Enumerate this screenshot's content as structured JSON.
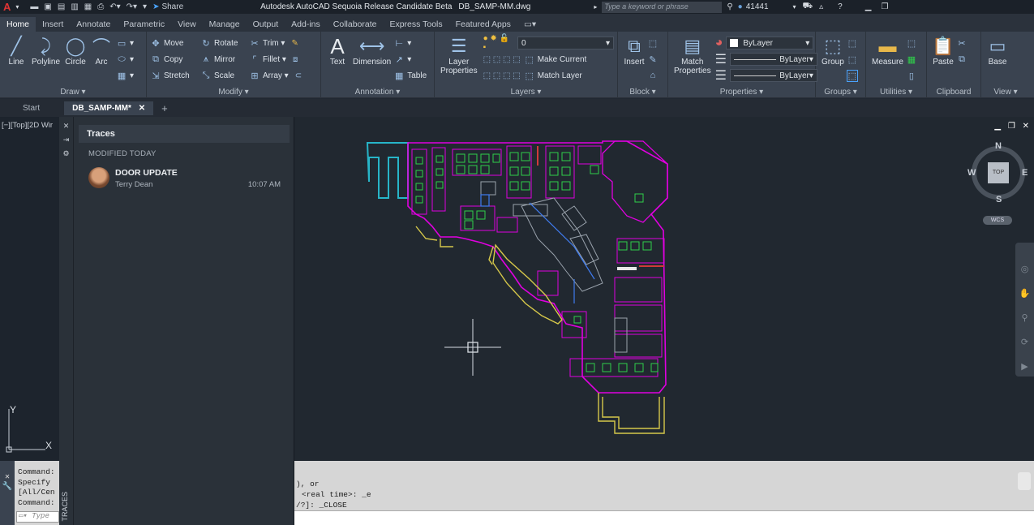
{
  "titlebar": {
    "app_letter": "A",
    "share_label": "Share",
    "title": "Autodesk AutoCAD Sequoia Release Candidate Beta",
    "filename": "DB_SAMP-MM.dwg",
    "search_placeholder": "Type a keyword or phrase",
    "user": "41441"
  },
  "ribbon_tabs": [
    "Home",
    "Insert",
    "Annotate",
    "Parametric",
    "View",
    "Manage",
    "Output",
    "Add-ins",
    "Collaborate",
    "Express Tools",
    "Featured Apps"
  ],
  "draw": {
    "line": "Line",
    "polyline": "Polyline",
    "circle": "Circle",
    "arc": "Arc",
    "title": "Draw"
  },
  "modify": {
    "move": "Move",
    "rotate": "Rotate",
    "trim": "Trim",
    "copy": "Copy",
    "mirror": "Mirror",
    "fillet": "Fillet",
    "stretch": "Stretch",
    "scale": "Scale",
    "array": "Array",
    "title": "Modify"
  },
  "annotation": {
    "text": "Text",
    "dimension": "Dimension",
    "table": "Table",
    "title": "Annotation"
  },
  "layers": {
    "layer_properties_1": "Layer",
    "layer_properties_2": "Properties",
    "layer_value": "0",
    "make_current": "Make Current",
    "match_layer": "Match Layer",
    "title": "Layers"
  },
  "block": {
    "insert": "Insert",
    "title": "Block"
  },
  "properties": {
    "match_1": "Match",
    "match_2": "Properties",
    "bylayer_color": "ByLayer",
    "bylayer_lineweight": "ByLayer",
    "bylayer_linetype": "ByLayer",
    "title": "Properties"
  },
  "groups": {
    "group": "Group",
    "title": "Groups"
  },
  "utilities": {
    "measure": "Measure",
    "title": "Utilities"
  },
  "clipboard": {
    "paste": "Paste",
    "title": "Clipboard"
  },
  "view": {
    "base": "Base",
    "title": "View"
  },
  "doc_tabs": {
    "start": "Start",
    "active": "DB_SAMP-MM*",
    "plus": "+"
  },
  "viewport_label": "[−][Top][2D Wir",
  "traces": {
    "title": "Traces",
    "section": "MODIFIED TODAY",
    "item_title": "DOOR UPDATE",
    "item_author": "Terry Dean",
    "item_time": "10:07 AM",
    "vertical_label": "TRACES"
  },
  "viewcube": {
    "n": "N",
    "s": "S",
    "e": "E",
    "w": "W",
    "top": "TOP",
    "wcs": "WCS"
  },
  "ucs": {
    "x": "X",
    "y": "Y"
  },
  "cmd_left": [
    "Command:",
    "Specify",
    "[All/Cen",
    "Command:"
  ],
  "cmd_input_placeholder": "Type",
  "cmd_history": [
    "), or",
    "<real time>: _e",
    "/?]: _CLOSE"
  ],
  "colors": {
    "accent": "#3a4350",
    "ribbon": "#3a4350",
    "viewport": "#212830",
    "magenta": "#e000e0",
    "yellow": "#d6c84a",
    "cyan": "#27b5c8",
    "green": "#2fcf4a"
  }
}
